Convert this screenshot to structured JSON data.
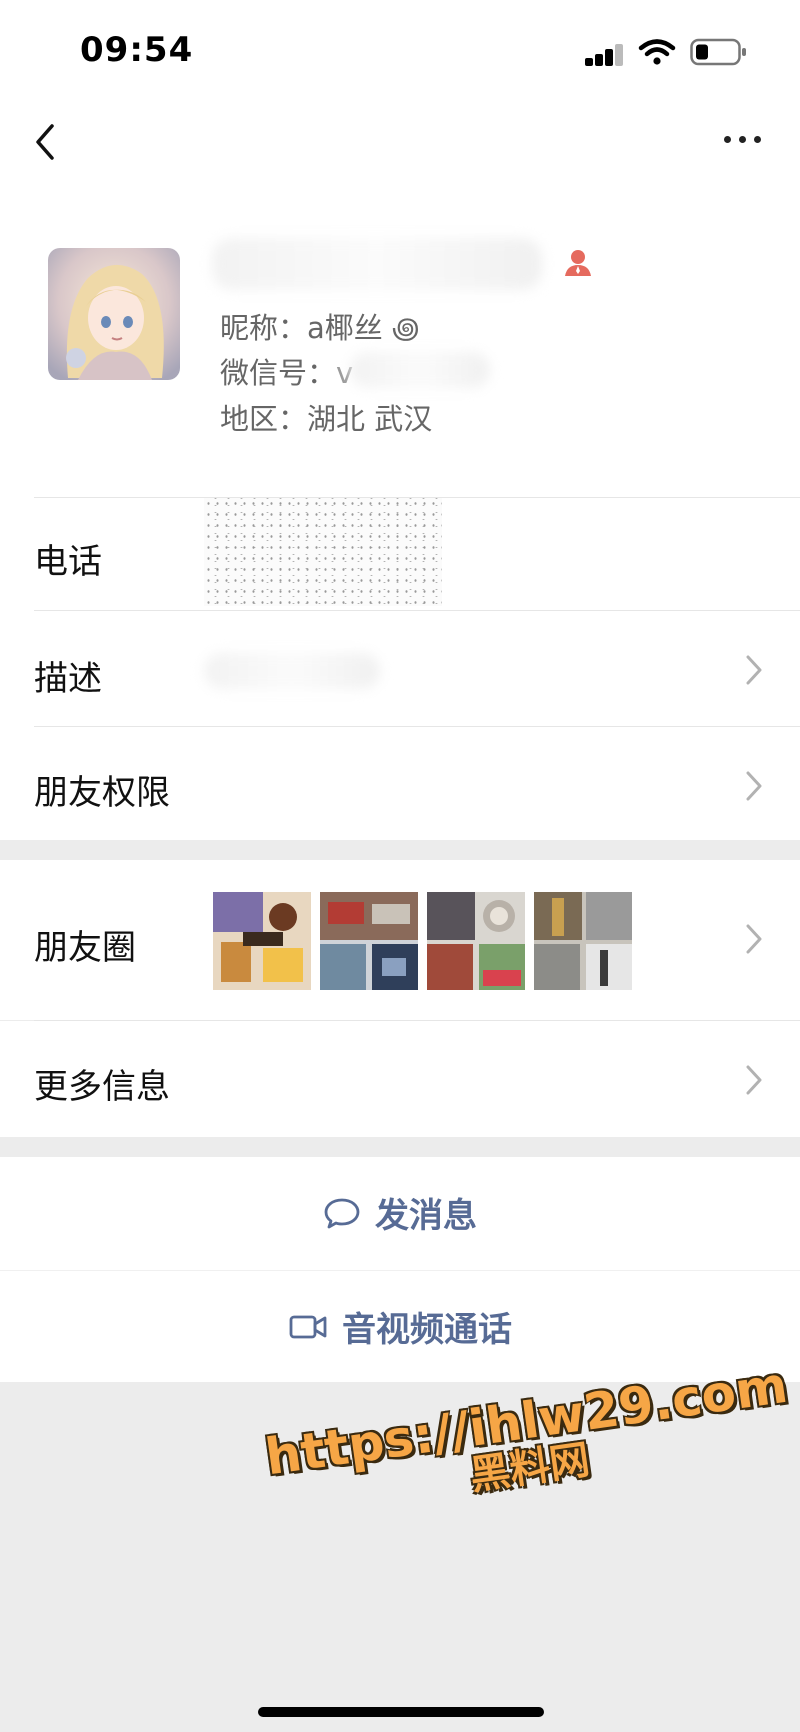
{
  "status_bar": {
    "time": "09:54"
  },
  "profile": {
    "nickname_label": "昵称：a椰丝 ꩜",
    "wechat_id_label": "微信号：",
    "wechat_id_visible": "v",
    "region_label": "地区：湖北 武汉"
  },
  "rows": {
    "phone": "电话",
    "description": "描述",
    "friend_permissions": "朋友权限",
    "moments": "朋友圈",
    "more_info": "更多信息"
  },
  "actions": {
    "send_message": "发消息",
    "video_call": "音视频通话"
  },
  "watermark": {
    "url": "https://ihlw29.com",
    "site": "黑料网"
  },
  "colors": {
    "accent": "#576b95",
    "page_bg": "#ececec",
    "watermark": "#f6a646"
  }
}
